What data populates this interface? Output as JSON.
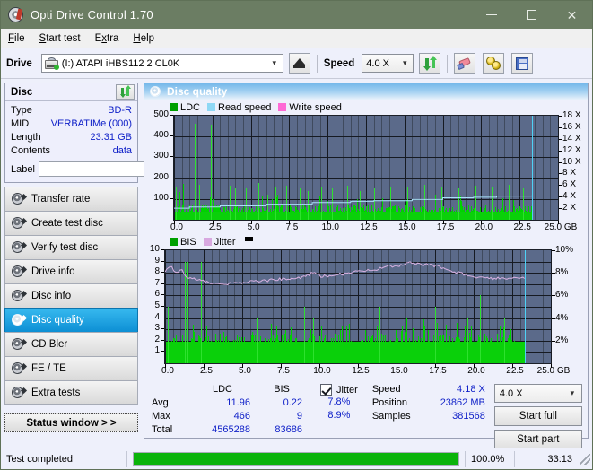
{
  "window": {
    "title": "Opti Drive Control 1.70",
    "icon": "optical-disc-icon",
    "minimize": "–",
    "maximize": "□",
    "close": "✕"
  },
  "menubar": {
    "items": [
      "File",
      "Start test",
      "Extra",
      "Help"
    ]
  },
  "toolbar": {
    "drive_label": "Drive",
    "drive_value": "(I:)  ATAPI iHBS112  2 CL0K",
    "eject_title": "eject-button",
    "speed_label": "Speed",
    "speed_value": "4.0 X",
    "refresh_title": "refresh-button",
    "erase_title": "erase-button",
    "tools_title": "tools-button",
    "save_title": "save-button"
  },
  "disc_panel": {
    "title": "Disc",
    "rows": [
      {
        "key": "Type",
        "value": "BD-R"
      },
      {
        "key": "MID",
        "value": "VERBATIMe (000)"
      },
      {
        "key": "Length",
        "value": "23.31 GB"
      },
      {
        "key": "Contents",
        "value": "data"
      }
    ],
    "label_key": "Label",
    "label_value": "",
    "label_placeholder": ""
  },
  "nav": {
    "items": [
      {
        "label": "Transfer rate",
        "active": false
      },
      {
        "label": "Create test disc",
        "active": false
      },
      {
        "label": "Verify test disc",
        "active": false
      },
      {
        "label": "Drive info",
        "active": false
      },
      {
        "label": "Disc info",
        "active": false
      },
      {
        "label": "Disc quality",
        "active": true
      },
      {
        "label": "CD Bler",
        "active": false
      },
      {
        "label": "FE / TE",
        "active": false
      },
      {
        "label": "Extra tests",
        "active": false
      }
    ],
    "status_window": "Status window > >"
  },
  "content": {
    "title": "Disc quality"
  },
  "chart_data": [
    {
      "type": "area",
      "name": "ldc-chart",
      "title": "",
      "xlabel": "GB",
      "ylabel": "",
      "xlim": [
        0.0,
        25.0
      ],
      "ylim": [
        0,
        500
      ],
      "y2lim": [
        0,
        18
      ],
      "xticks": [
        "0.0",
        "2.5",
        "5.0",
        "7.5",
        "10.0",
        "12.5",
        "15.0",
        "17.5",
        "20.0",
        "22.5",
        "25.0 GB"
      ],
      "yticks": [
        "100",
        "200",
        "300",
        "400",
        "500"
      ],
      "y2ticks": [
        "2 X",
        "4 X",
        "6 X",
        "8 X",
        "10 X",
        "12 X",
        "14 X",
        "16 X",
        "18 X"
      ],
      "grid": true,
      "legend_position": "top-left",
      "legend": [
        {
          "name": "LDC",
          "color": "#00a000"
        },
        {
          "name": "Read speed",
          "color": "#8fd8f5"
        },
        {
          "name": "Write speed",
          "color": "#ff6ad5"
        }
      ],
      "data_end_gb": 23.3,
      "series": [
        {
          "name": "LDC",
          "color": "#00d200",
          "type": "bar",
          "note": "dense green spikes, base band ~40-70, peaks to 466",
          "peaks": [
            {
              "x": 1.35,
              "y": 462
            },
            {
              "x": 2.4,
              "y": 458
            },
            {
              "x": 0.1,
              "y": 155
            },
            {
              "x": 1.65,
              "y": 170
            },
            {
              "x": 3.6,
              "y": 165
            },
            {
              "x": 4.0,
              "y": 150
            },
            {
              "x": 4.7,
              "y": 150
            },
            {
              "x": 5.5,
              "y": 175
            },
            {
              "x": 6.1,
              "y": 120
            },
            {
              "x": 6.6,
              "y": 160
            },
            {
              "x": 7.3,
              "y": 165
            },
            {
              "x": 8.2,
              "y": 150
            },
            {
              "x": 8.7,
              "y": 140
            },
            {
              "x": 9.6,
              "y": 160
            },
            {
              "x": 10.3,
              "y": 150
            },
            {
              "x": 11.3,
              "y": 165
            },
            {
              "x": 12.1,
              "y": 140
            },
            {
              "x": 13.0,
              "y": 150
            },
            {
              "x": 14.1,
              "y": 160
            },
            {
              "x": 15.2,
              "y": 155
            },
            {
              "x": 16.3,
              "y": 170
            },
            {
              "x": 17.4,
              "y": 160
            },
            {
              "x": 18.5,
              "y": 150
            },
            {
              "x": 19.6,
              "y": 165
            },
            {
              "x": 20.7,
              "y": 155
            },
            {
              "x": 21.8,
              "y": 170
            },
            {
              "x": 22.7,
              "y": 150
            }
          ]
        },
        {
          "name": "Read speed",
          "color": "#a8e0f7",
          "type": "step-line",
          "points": [
            {
              "x": 0.0,
              "y_x": 2.0
            },
            {
              "x": 1.0,
              "y_x": 2.2
            },
            {
              "x": 3.0,
              "y_x": 2.4
            },
            {
              "x": 6.0,
              "y_x": 2.7
            },
            {
              "x": 9.0,
              "y_x": 3.0
            },
            {
              "x": 11.5,
              "y_x": 3.2
            },
            {
              "x": 13.0,
              "y_x": 3.3
            },
            {
              "x": 15.5,
              "y_x": 3.5
            },
            {
              "x": 17.5,
              "y_x": 3.8
            },
            {
              "x": 19.5,
              "y_x": 3.9
            },
            {
              "x": 21.0,
              "y_x": 4.1
            },
            {
              "x": 23.3,
              "y_x": 4.2
            }
          ]
        }
      ],
      "marker_line": {
        "x": 23.3,
        "color": "#4fd2f5"
      }
    },
    {
      "type": "area",
      "name": "bis-jitter-chart",
      "title": "",
      "xlabel": "GB",
      "ylabel": "",
      "xlim": [
        0.0,
        25.0
      ],
      "ylim": [
        0,
        10
      ],
      "y2lim": [
        0,
        10
      ],
      "xticks": [
        "0.0",
        "2.5",
        "5.0",
        "7.5",
        "10.0",
        "12.5",
        "15.0",
        "17.5",
        "20.0",
        "22.5",
        "25.0 GB"
      ],
      "yticks": [
        "1",
        "2",
        "3",
        "4",
        "5",
        "6",
        "7",
        "8",
        "9",
        "10"
      ],
      "y2ticks": [
        "2%",
        "4%",
        "6%",
        "8%",
        "10%"
      ],
      "grid": true,
      "legend_position": "top-left",
      "legend": [
        {
          "name": "BIS",
          "color": "#00a000"
        },
        {
          "name": "Jitter",
          "color": "#d8a8e0"
        }
      ],
      "data_end_gb": 23.3,
      "series": [
        {
          "name": "BIS",
          "color": "#00d200",
          "type": "bar",
          "note": "dense green band base ~2-3, spikes to 5-6, max 9",
          "peaks": [
            {
              "x": 0.2,
              "y": 5
            },
            {
              "x": 1.3,
              "y": 9
            },
            {
              "x": 1.45,
              "y": 9
            },
            {
              "x": 2.35,
              "y": 9
            },
            {
              "x": 6.0,
              "y": 4
            },
            {
              "x": 9.0,
              "y": 5
            },
            {
              "x": 9.6,
              "y": 4
            },
            {
              "x": 13.9,
              "y": 5
            },
            {
              "x": 17.5,
              "y": 5
            },
            {
              "x": 20.4,
              "y": 6
            },
            {
              "x": 19.6,
              "y": 4
            },
            {
              "x": 22.0,
              "y": 4
            }
          ]
        },
        {
          "name": "Jitter",
          "color": "#d9b2e3",
          "type": "line",
          "points": [
            {
              "x": 0.0,
              "y": 8.0
            },
            {
              "x": 0.3,
              "y": 8.6
            },
            {
              "x": 0.7,
              "y": 8.1
            },
            {
              "x": 1.1,
              "y": 8.3
            },
            {
              "x": 1.4,
              "y": 7.6
            },
            {
              "x": 2.0,
              "y": 7.4
            },
            {
              "x": 2.6,
              "y": 7.2
            },
            {
              "x": 3.5,
              "y": 7.1
            },
            {
              "x": 4.3,
              "y": 7.05
            },
            {
              "x": 5.2,
              "y": 7.2
            },
            {
              "x": 6.2,
              "y": 7.3
            },
            {
              "x": 7.2,
              "y": 7.4
            },
            {
              "x": 8.2,
              "y": 7.5
            },
            {
              "x": 9.0,
              "y": 7.6
            },
            {
              "x": 9.7,
              "y": 8.1
            },
            {
              "x": 10.1,
              "y": 7.7
            },
            {
              "x": 11.0,
              "y": 7.8
            },
            {
              "x": 12.0,
              "y": 8.0
            },
            {
              "x": 12.8,
              "y": 8.2
            },
            {
              "x": 13.6,
              "y": 8.3
            },
            {
              "x": 14.5,
              "y": 8.6
            },
            {
              "x": 15.4,
              "y": 8.7
            },
            {
              "x": 16.0,
              "y": 8.9
            },
            {
              "x": 16.6,
              "y": 8.7
            },
            {
              "x": 17.2,
              "y": 8.7
            },
            {
              "x": 17.8,
              "y": 8.5
            },
            {
              "x": 18.4,
              "y": 8.2
            },
            {
              "x": 19.0,
              "y": 8.0
            },
            {
              "x": 19.6,
              "y": 7.8
            },
            {
              "x": 20.3,
              "y": 7.6
            },
            {
              "x": 21.0,
              "y": 7.5
            },
            {
              "x": 21.8,
              "y": 7.5
            },
            {
              "x": 22.5,
              "y": 7.5
            },
            {
              "x": 23.3,
              "y": 7.5
            }
          ]
        }
      ],
      "marker_line": {
        "x": 23.3,
        "color": "#4fd2f5"
      }
    }
  ],
  "stats": {
    "columns": [
      "LDC",
      "BIS"
    ],
    "rows": [
      {
        "label": "Avg",
        "ldc": "11.96",
        "bis": "0.22"
      },
      {
        "label": "Max",
        "ldc": "466",
        "bis": "9"
      },
      {
        "label": "Total",
        "ldc": "4565288",
        "bis": "83686"
      }
    ],
    "jitter": {
      "checked": true,
      "label": "Jitter",
      "avg": "7.8%",
      "max": "8.9%"
    },
    "readout": [
      {
        "label": "Speed",
        "value": "4.18 X"
      },
      {
        "label": "Position",
        "value": "23862 MB"
      },
      {
        "label": "Samples",
        "value": "381568"
      }
    ],
    "speed_select": "4.0 X",
    "start_full": "Start full",
    "start_part": "Start part"
  },
  "statusbar": {
    "message": "Test completed",
    "progress_pct": 100.0,
    "progress_text": "100.0%",
    "elapsed": "33:13"
  }
}
